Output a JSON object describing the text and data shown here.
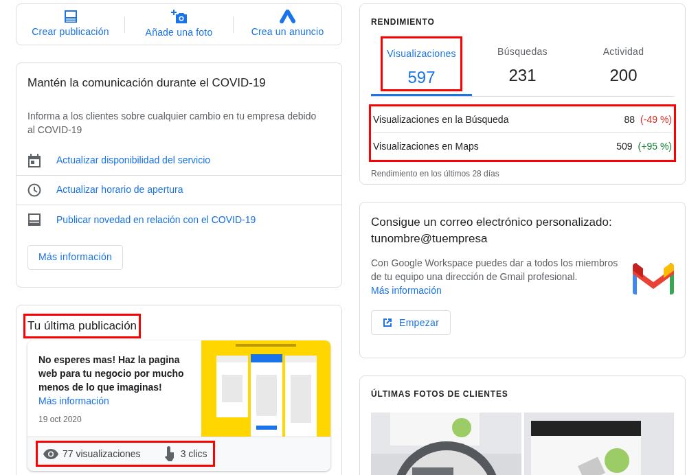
{
  "quick_actions": [
    {
      "label": "Crear publicación"
    },
    {
      "label": "Añade una foto"
    },
    {
      "label": "Crea un anuncio"
    }
  ],
  "covid_card": {
    "title": "Mantén la comunicación durante el COVID-19",
    "description": "Informa a los clientes sobre cualquier cambio en tu empresa debido al COVID-19",
    "links": [
      {
        "label": "Actualizar disponibilidad del servicio"
      },
      {
        "label": "Actualizar horario de apertura"
      },
      {
        "label": "Publicar novedad en relación con el COVID-19"
      }
    ],
    "button": "Más información"
  },
  "latest_post": {
    "title": "Tu última publicación",
    "title_highlighted": true,
    "text": "No esperes mas! Haz la pagina web para tu negocio por mucho menos de lo que imaginas!",
    "link": "Más información",
    "date": "19 oct 2020",
    "stats_highlighted": true,
    "views": "77 visualizaciones",
    "clicks": "3 clics"
  },
  "performance": {
    "heading": "RENDIMIENTO",
    "tabs": [
      {
        "label": "Visualizaciones",
        "value": "597",
        "selected": true,
        "highlighted": true
      },
      {
        "label": "Búsquedas",
        "value": "231",
        "selected": false,
        "highlighted": false
      },
      {
        "label": "Actividad",
        "value": "200",
        "selected": false,
        "highlighted": false
      }
    ],
    "rows_highlighted": true,
    "rows": [
      {
        "label": "Visualizaciones en la Búsqueda",
        "value": "88",
        "change": "(-49 %)",
        "color": "#d93025"
      },
      {
        "label": "Visualizaciones en Maps",
        "value": "509",
        "change": "(+95 %)",
        "color": "#188038"
      }
    ],
    "footnote": "Rendimiento en los últimos 28 días"
  },
  "email_card": {
    "title": "Consigue un correo electrónico personalizado: tunombre@tuempresa",
    "text": "Con Google Workspace puedes dar a todos los miembros de tu equipo una dirección de Gmail profesional.",
    "link": "Más información",
    "button": "Empezar"
  },
  "customer_photos": {
    "heading": "ÚLTIMAS FOTOS DE CLIENTES"
  }
}
